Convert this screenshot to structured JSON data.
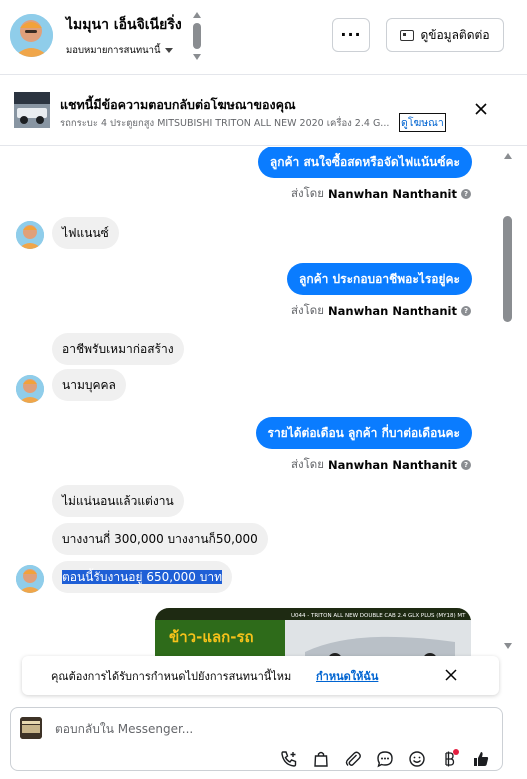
{
  "header": {
    "contact_name": "ไมมุนา เอ็นจิเนียริ่ง",
    "assign_label": "มอบหมายการสนทนานี้",
    "more_label": "···",
    "contact_info_label": "ดูข้อมูลติดต่อ"
  },
  "ad_banner": {
    "title": "แชทนี้มีข้อความตอบกลับต่อโฆษณาของคุณ",
    "subtitle": "รถกระบะ 4 ประตูยกสูง MITSUBISHI TRITON ALL NEW 2020 เครื่อง 2.4 G...",
    "link_label": "ดูโฆษณา"
  },
  "messages": {
    "m1": "ลูกค้า สนใจซื้อสดหรือจัดไฟแน้นซ์คะ",
    "m2": "ไฟแนนซ์",
    "m3": "ลูกค้า ประกอบอาชีพอะไรอยู่คะ",
    "m4": "อาชีพรับเหมาก่อสร้าง",
    "m5": "นามบุคคล",
    "m6": "รายได้ต่อเดือน  ลูกค้า กี่บาต่อเดือนคะ",
    "m7": "ไม่แน่นอนแล้วแต่งาน",
    "m8": "บางงานกี่ 300,000 บางงานก็50,000",
    "m9": "ตอนนี้รับงานอยู่ 650,000 บาท"
  },
  "sent_by": {
    "prefix": "ส่งโดย",
    "agent": "Nanwhan Nanthanit",
    "info_icon": "?"
  },
  "attachment": {
    "image_caption": "U044 - TRITON ALL NEW DOUBLE CAB 2.4 GLX PLUS (MY18) MT",
    "promo_text": "ข้าว-แลก-รถ"
  },
  "notice": {
    "text": "คุณต้องการได้รับการกำหนดไปยังการสนทนานี้ไหม",
    "link_label": "กำหนดให้ฉัน"
  },
  "composer": {
    "placeholder": "ตอบกลับใน Messenger..."
  },
  "colors": {
    "outgoing_bubble": "#0a7cff",
    "incoming_bubble": "#f0f0f0",
    "link": "#0064d1",
    "highlight": "#1f5fd6",
    "notification_dot": "#e41e3f"
  }
}
